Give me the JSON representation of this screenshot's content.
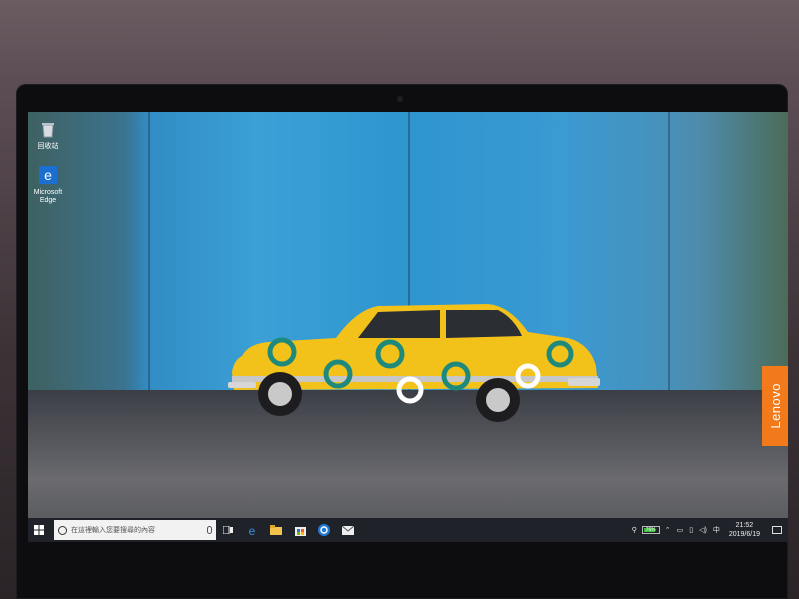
{
  "desktop": {
    "icons": [
      {
        "label": "回收站",
        "icon": "recycle-bin-icon"
      },
      {
        "label": "Microsoft Edge",
        "icon": "edge-icon"
      }
    ],
    "wallpaper_brand": "Lenovo"
  },
  "taskbar": {
    "search_placeholder": "在這裡輸入您要搜尋的內容",
    "apps": [
      "task-view-icon",
      "edge-icon",
      "file-explorer-icon",
      "store-icon",
      "cortana-icon",
      "mail-icon"
    ],
    "tray": {
      "battery_percent": "76%",
      "battery_level": 0.76,
      "ime": "中",
      "time": "21:52",
      "date": "2019/6/19"
    }
  },
  "colors": {
    "car": "#f2c21b",
    "wall": "#3a9ad2",
    "lenovo": "#f27a1a",
    "taskbar": "#1f2329"
  }
}
